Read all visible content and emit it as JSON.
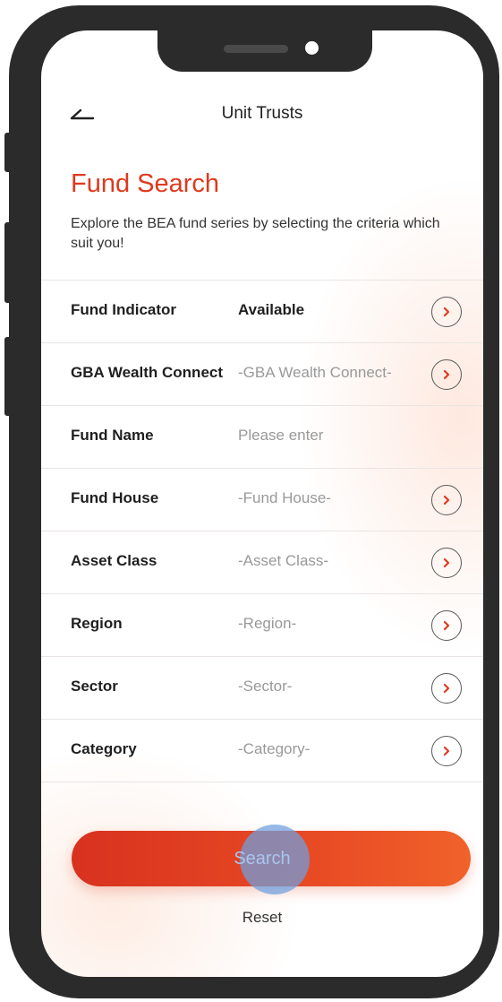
{
  "header": {
    "title": "Unit Trusts"
  },
  "page": {
    "title": "Fund Search",
    "intro": "Explore the BEA fund series by selecting the criteria which suit you!"
  },
  "fields": [
    {
      "label": "Fund Indicator",
      "value": "Available",
      "chevron": true
    },
    {
      "label": "GBA Wealth Connect",
      "value": "-GBA Wealth Connect-",
      "chevron": true
    },
    {
      "label": "Fund Name",
      "value": "Please enter",
      "chevron": false
    },
    {
      "label": "Fund House",
      "value": "-Fund House-",
      "chevron": true
    },
    {
      "label": "Asset Class",
      "value": "-Asset Class-",
      "chevron": true
    },
    {
      "label": "Region",
      "value": "-Region-",
      "chevron": true
    },
    {
      "label": "Sector",
      "value": "-Sector-",
      "chevron": true
    },
    {
      "label": "Category",
      "value": "-Category-",
      "chevron": true
    }
  ],
  "actions": {
    "search": "Search",
    "reset": "Reset"
  },
  "colors": {
    "accent": "#e0391e",
    "button_start": "#d8321f",
    "button_end": "#f0622a"
  },
  "icons": {
    "back": "back-arrow-icon",
    "row": "chevron-right-icon"
  }
}
